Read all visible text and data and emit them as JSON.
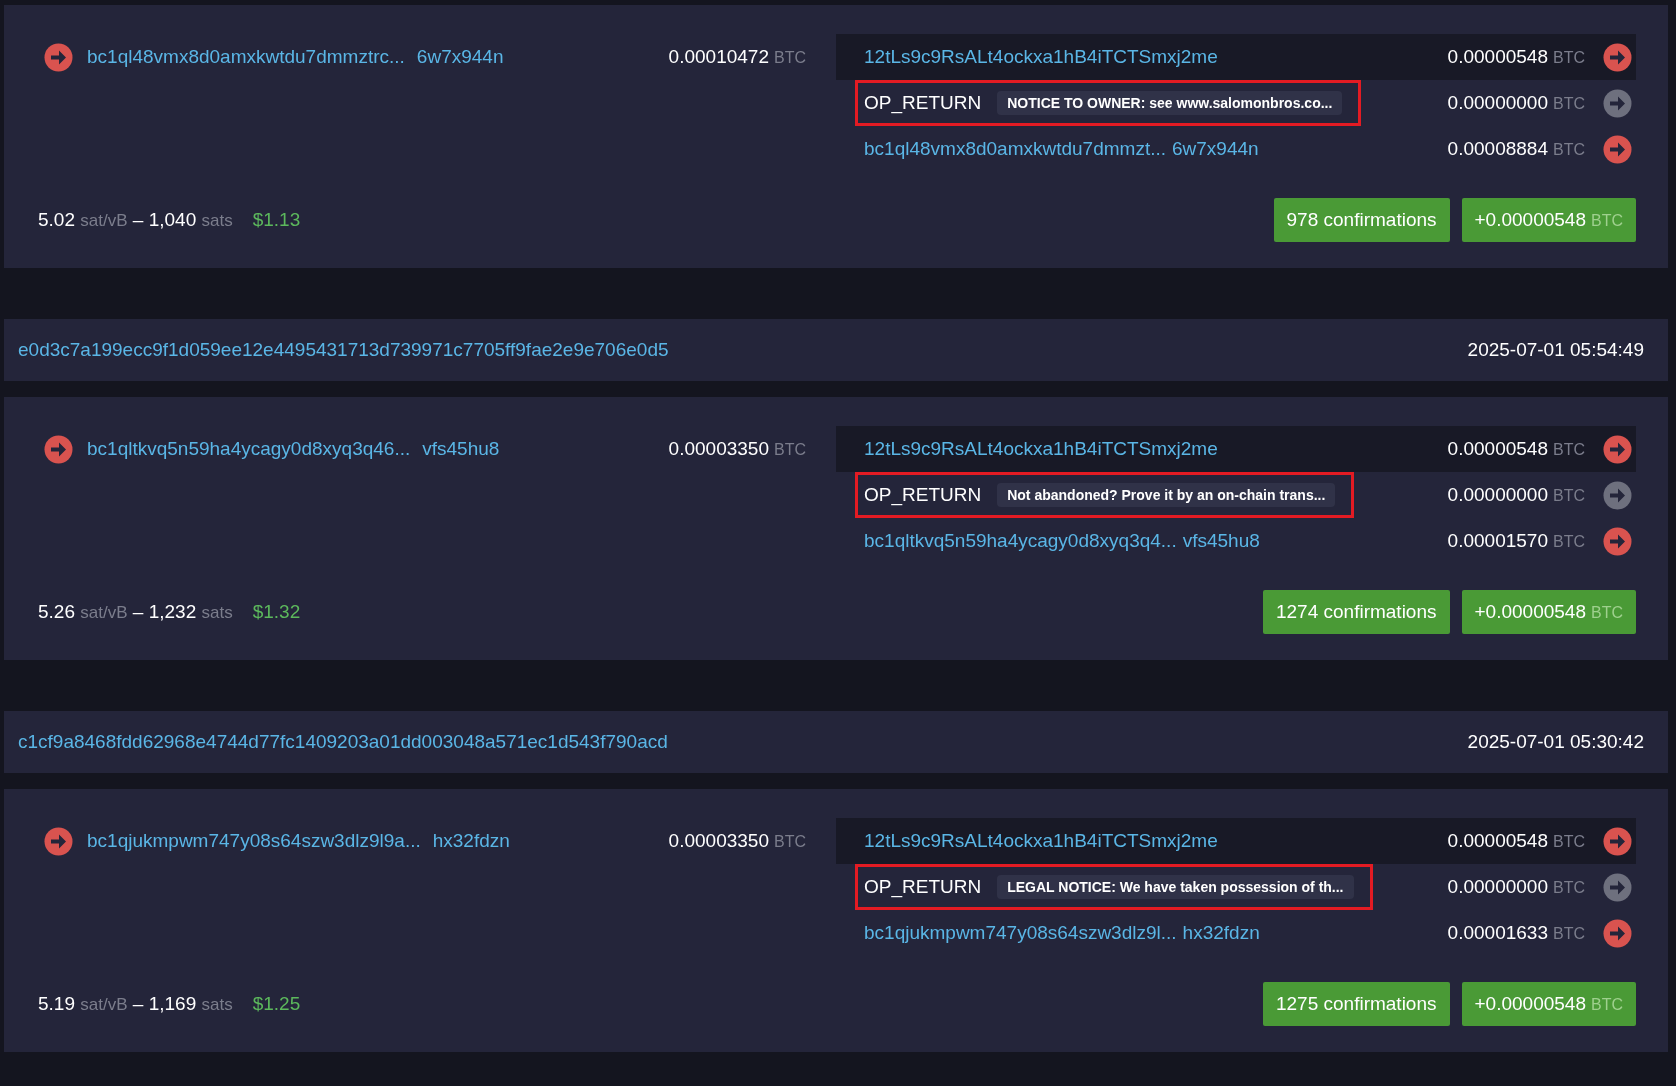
{
  "transactions": [
    {
      "inputs": [
        {
          "address": "bc1ql48vmx8d0amxkwtdu7dmmztrc...",
          "suffix": "6w7x944n",
          "amount": "0.00010472",
          "unit": "BTC"
        }
      ],
      "outputs": [
        {
          "kind": "address",
          "address": "12tLs9c9RsALt4ockxa1hB4iTCTSmxj2me",
          "amount": "0.00000548",
          "unit": "BTC",
          "highlighted": true,
          "annotated": false
        },
        {
          "kind": "op_return",
          "label": "OP_RETURN",
          "message": "NOTICE TO OWNER: see www.salomonbros.co...",
          "amount": "0.00000000",
          "unit": "BTC",
          "highlighted": false,
          "annotated": true
        },
        {
          "kind": "address",
          "address": "bc1ql48vmx8d0amxkwtdu7dmmzt...",
          "suffix": "6w7x944n",
          "amount": "0.00008884",
          "unit": "BTC",
          "highlighted": false,
          "annotated": false
        }
      ],
      "fee": {
        "rate": "5.02",
        "rate_unit": "sat/vB",
        "dash": "–",
        "sats": "1,040",
        "sats_unit": "sats",
        "usd": "$1.13"
      },
      "confirmations": "978 confirmations",
      "net_amount": "+0.00000548",
      "net_unit": "BTC"
    },
    {
      "txid": "e0d3c7a199ecc9f1d059ee12e4495431713d739971c7705ff9fae2e9e706e0d5",
      "time": "2025-07-01 05:54:49",
      "inputs": [
        {
          "address": "bc1qltkvq5n59ha4ycagy0d8xyq3q46...",
          "suffix": "vfs45hu8",
          "amount": "0.00003350",
          "unit": "BTC"
        }
      ],
      "outputs": [
        {
          "kind": "address",
          "address": "12tLs9c9RsALt4ockxa1hB4iTCTSmxj2me",
          "amount": "0.00000548",
          "unit": "BTC",
          "highlighted": true,
          "annotated": false
        },
        {
          "kind": "op_return",
          "label": "OP_RETURN",
          "message": "Not abandoned? Prove it by an on-chain trans...",
          "amount": "0.00000000",
          "unit": "BTC",
          "highlighted": false,
          "annotated": true
        },
        {
          "kind": "address",
          "address": "bc1qltkvq5n59ha4ycagy0d8xyq3q4...",
          "suffix": "vfs45hu8",
          "amount": "0.00001570",
          "unit": "BTC",
          "highlighted": false,
          "annotated": false
        }
      ],
      "fee": {
        "rate": "5.26",
        "rate_unit": "sat/vB",
        "dash": "–",
        "sats": "1,232",
        "sats_unit": "sats",
        "usd": "$1.32"
      },
      "confirmations": "1274 confirmations",
      "net_amount": "+0.00000548",
      "net_unit": "BTC"
    },
    {
      "txid": "c1cf9a8468fdd62968e4744d77fc1409203a01dd003048a571ec1d543f790acd",
      "time": "2025-07-01 05:30:42",
      "inputs": [
        {
          "address": "bc1qjukmpwm747y08s64szw3dlz9l9a...",
          "suffix": "hx32fdzn",
          "amount": "0.00003350",
          "unit": "BTC"
        }
      ],
      "outputs": [
        {
          "kind": "address",
          "address": "12tLs9c9RsALt4ockxa1hB4iTCTSmxj2me",
          "amount": "0.00000548",
          "unit": "BTC",
          "highlighted": true,
          "annotated": false
        },
        {
          "kind": "op_return",
          "label": "OP_RETURN",
          "message": "LEGAL NOTICE: We have taken possession of th...",
          "amount": "0.00000000",
          "unit": "BTC",
          "highlighted": false,
          "annotated": true
        },
        {
          "kind": "address",
          "address": "bc1qjukmpwm747y08s64szw3dlz9l...",
          "suffix": "hx32fdzn",
          "amount": "0.00001633",
          "unit": "BTC",
          "highlighted": false,
          "annotated": false
        }
      ],
      "fee": {
        "rate": "5.19",
        "rate_unit": "sat/vB",
        "dash": "–",
        "sats": "1,169",
        "sats_unit": "sats",
        "usd": "$1.25"
      },
      "confirmations": "1275 confirmations",
      "net_amount": "+0.00000548",
      "net_unit": "BTC"
    }
  ]
}
